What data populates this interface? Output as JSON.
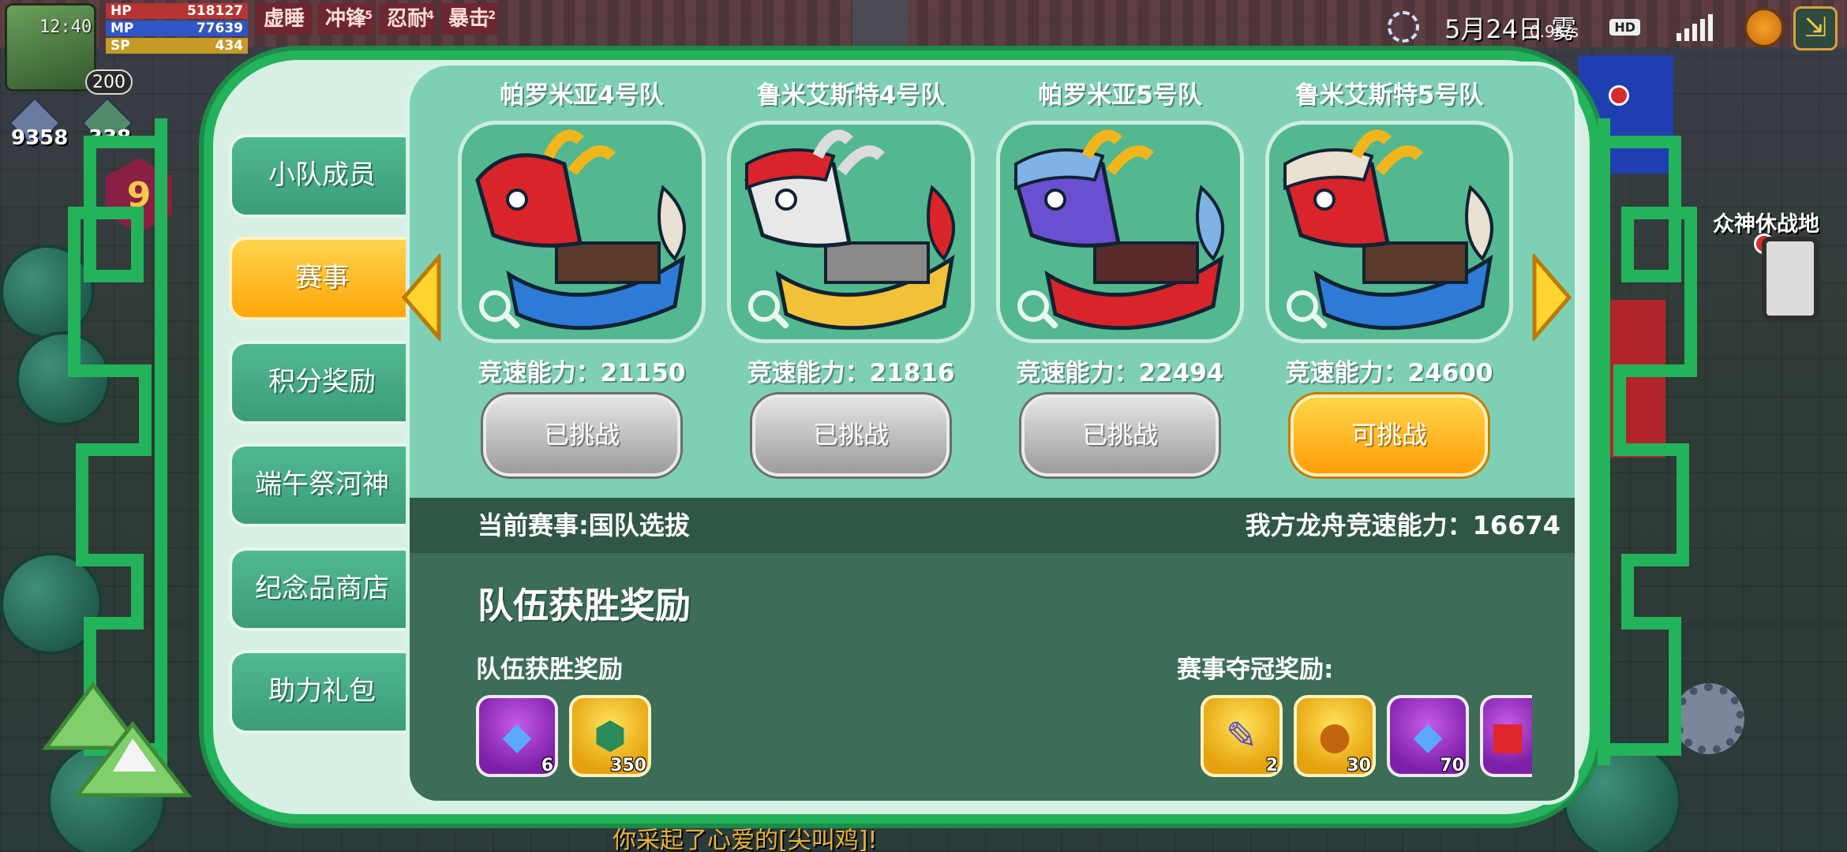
{
  "status_bar": {
    "time": "12:40",
    "date": "5月24日",
    "weather_label": "雾",
    "net_speed": "0.9K/s",
    "hd": "HD",
    "network": "4G"
  },
  "player": {
    "level": "200",
    "hp_label": "HP",
    "hp_value": "518127",
    "mp_label": "MP",
    "mp_value": "77639",
    "sp_label": "SP",
    "sp_value": "434",
    "buffs": [
      {
        "label": "虚睡",
        "count": ""
      },
      {
        "label": "冲锋",
        "count": "5"
      },
      {
        "label": "忍耐",
        "count": "4"
      },
      {
        "label": "暴击",
        "count": "2"
      }
    ],
    "resource_1": "9358",
    "resource_2": "338",
    "hex_badge": "9"
  },
  "map": {
    "poi_label": "众神休战地",
    "chat_message": "你采起了心爱的[尖叫鸡]!"
  },
  "tabs": [
    {
      "label": "小队成员",
      "active": false
    },
    {
      "label": "赛事",
      "active": true
    },
    {
      "label": "积分奖励",
      "active": false
    },
    {
      "label": "端午祭河神",
      "active": false
    },
    {
      "label": "纪念品商店",
      "active": false
    },
    {
      "label": "助力礼包",
      "active": false
    }
  ],
  "teams": [
    {
      "name": "帕罗米亚4号队",
      "speed_text": "竞速能力：21150",
      "button": "已挑战",
      "available": false
    },
    {
      "name": "鲁米艾斯特4号队",
      "speed_text": "竞速能力：21816",
      "button": "已挑战",
      "available": false
    },
    {
      "name": "帕罗米亚5号队",
      "speed_text": "竞速能力：22494",
      "button": "已挑战",
      "available": false
    },
    {
      "name": "鲁米艾斯特5号队",
      "speed_text": "竞速能力：24600",
      "button": "可挑战",
      "available": true
    }
  ],
  "info_strip": {
    "current_event": "当前赛事:国队选拔",
    "our_speed": "我方龙舟竞速能力：16674"
  },
  "rewards": {
    "title": "队伍获胜奖励",
    "team_win_label": "队伍获胜奖励",
    "champion_label": "赛事夺冠奖励:",
    "team_win_items": [
      {
        "icon": "purple-gem-icon",
        "qty": "6",
        "style": "purple"
      },
      {
        "icon": "green-gem-icon",
        "qty": "350",
        "style": "gold"
      }
    ],
    "champion_items": [
      {
        "icon": "scroll-icon",
        "qty": "2",
        "style": "gold"
      },
      {
        "icon": "handshake-coin-icon",
        "qty": "30",
        "style": "gold"
      },
      {
        "icon": "purple-gem-icon",
        "qty": "70",
        "style": "purple"
      },
      {
        "icon": "red-envelope-icon",
        "qty": "",
        "style": "purple"
      }
    ]
  },
  "colors": {
    "frame_green": "#23b35a",
    "panel_teal": "#7ed0b5",
    "active_tab_orange": "#ffa60a",
    "reward_bg": "#3c6d56"
  }
}
